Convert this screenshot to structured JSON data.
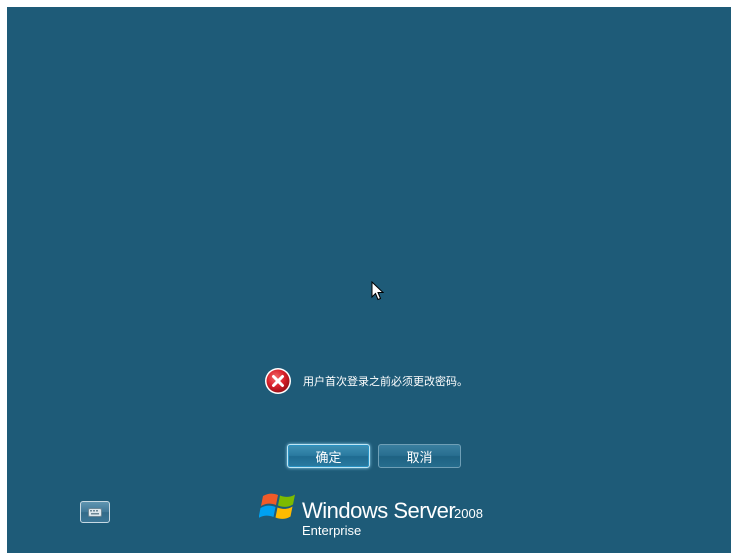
{
  "message": {
    "icon": "error-icon",
    "text": "用户首次登录之前必须更改密码。"
  },
  "buttons": {
    "ok_label": "确定",
    "cancel_label": "取消"
  },
  "accessibility": {
    "icon": "keyboard-icon"
  },
  "branding": {
    "product": "Windows Server",
    "version": "2008",
    "edition": "Enterprise"
  },
  "colors": {
    "background": "#1e5b78",
    "error_red": "#d8202a",
    "text": "#ffffff"
  }
}
